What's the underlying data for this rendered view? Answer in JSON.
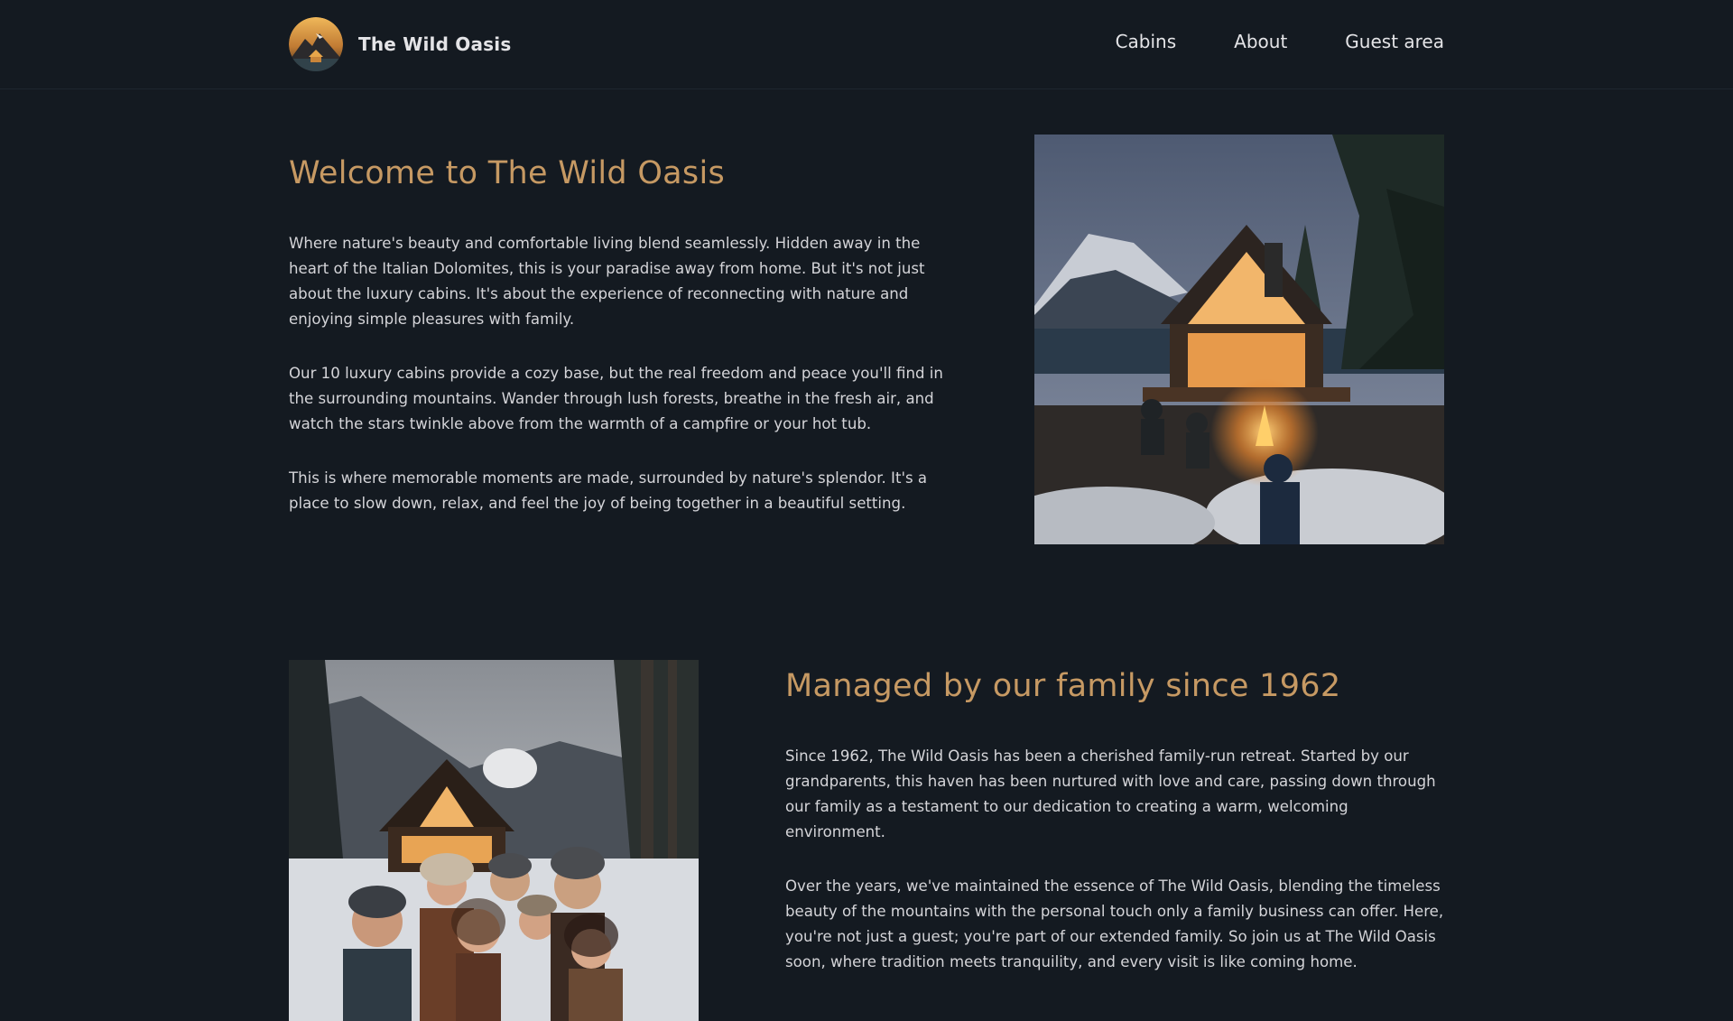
{
  "header": {
    "brand": "The Wild Oasis",
    "nav": [
      {
        "label": "Cabins"
      },
      {
        "label": "About"
      },
      {
        "label": "Guest area"
      }
    ]
  },
  "section1": {
    "title": "Welcome to The Wild Oasis",
    "paragraphs": [
      "Where nature's beauty and comfortable living blend seamlessly. Hidden away in the heart of the Italian Dolomites, this is your paradise away from home. But it's not just about the luxury cabins. It's about the experience of reconnecting with nature and enjoying simple pleasures with family.",
      "Our 10 luxury cabins provide a cozy base, but the real freedom and peace you'll find in the surrounding mountains. Wander through lush forests, breathe in the fresh air, and watch the stars twinkle above from the warmth of a campfire or your hot tub.",
      "This is where memorable moments are made, surrounded by nature's splendor. It's a place to slow down, relax, and feel the joy of being together in a beautiful setting."
    ]
  },
  "section2": {
    "title": "Managed by our family since 1962",
    "paragraphs": [
      "Since 1962, The Wild Oasis has been a cherished family-run retreat. Started by our grandparents, this haven has been nurtured with love and care, passing down through our family as a testament to our dedication to creating a warm, welcoming environment.",
      "Over the years, we've maintained the essence of The Wild Oasis, blending the timeless beauty of the mountains with the personal touch only a family business can offer. Here, you're not just a guest; you're part of our extended family. So join us at The Wild Oasis soon, where tradition meets tranquility, and every visit is like coming home."
    ]
  },
  "colors": {
    "background": "#141a21",
    "accent": "#c69963",
    "text": "#d4d4d8"
  }
}
